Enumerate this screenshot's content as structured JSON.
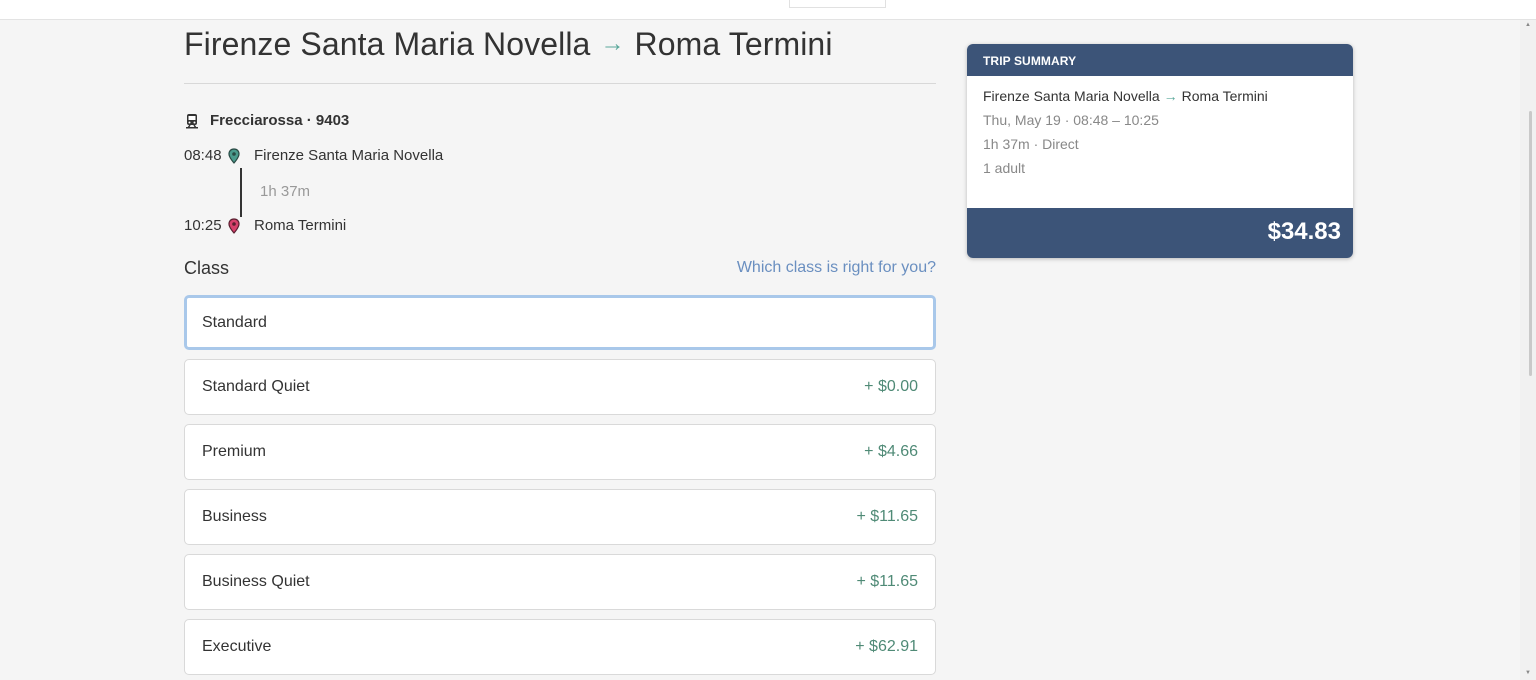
{
  "page": {
    "title_from": "Firenze Santa Maria Novella",
    "title_arrow": "→",
    "title_to": "Roma Termini"
  },
  "train": {
    "icon": "train-icon",
    "label": "Frecciarossa · 9403",
    "departure_time": "08:48",
    "departure_station": "Firenze Santa Maria Novella",
    "duration": "1h 37m",
    "arrival_time": "10:25",
    "arrival_station": "Roma Termini",
    "departure_pin_color": "#4a9a8c",
    "arrival_pin_color": "#d6406b"
  },
  "class_section": {
    "heading": "Class",
    "help_link": "Which class is right for you?",
    "options": [
      {
        "name": "Standard",
        "price": "",
        "selected": true
      },
      {
        "name": "Standard Quiet",
        "price": "+ $0.00",
        "selected": false
      },
      {
        "name": "Premium",
        "price": "+ $4.66",
        "selected": false
      },
      {
        "name": "Business",
        "price": "+ $11.65",
        "selected": false
      },
      {
        "name": "Business Quiet",
        "price": "+ $11.65",
        "selected": false
      },
      {
        "name": "Executive",
        "price": "+ $62.91",
        "selected": false
      }
    ]
  },
  "summary": {
    "heading": "TRIP SUMMARY",
    "route_from": "Firenze Santa Maria Novella",
    "route_arrow": "→",
    "route_to": "Roma Termini",
    "date_time": "Thu, May 19 · 08:48 – 10:25",
    "duration_type": "1h 37m · Direct",
    "passengers": "1 adult",
    "total": "$34.83"
  },
  "colors": {
    "accent_navy": "#3c5478",
    "arrow_green": "#5aa89a",
    "link_blue": "#6a8fc0",
    "price_green": "#4f8a76",
    "selected_border": "#a9c8ea"
  }
}
